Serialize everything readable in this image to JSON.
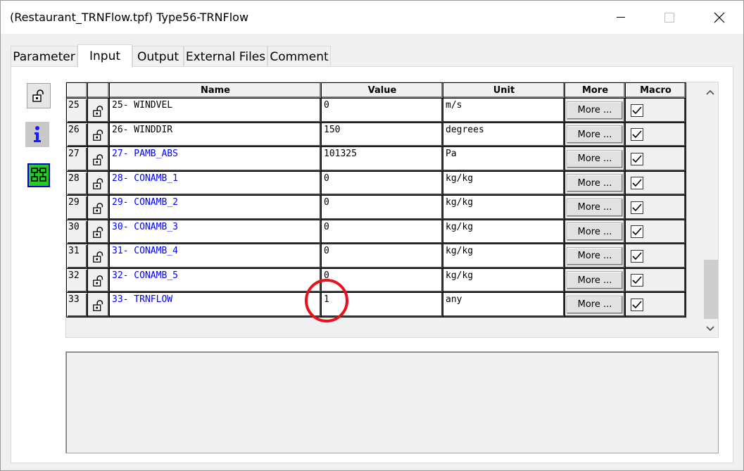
{
  "window": {
    "title": "(Restaurant_TRNFlow.tpf) Type56-TRNFlow"
  },
  "tabs": [
    {
      "label": "Parameter",
      "active": false
    },
    {
      "label": "Input",
      "active": true
    },
    {
      "label": "Output",
      "active": false
    },
    {
      "label": "External Files",
      "active": false
    },
    {
      "label": "Comment",
      "active": false
    }
  ],
  "side_buttons": [
    {
      "icon": "lock-icon"
    },
    {
      "icon": "info-icon"
    },
    {
      "icon": "grid-view-icon"
    }
  ],
  "grid": {
    "columns": [
      "",
      "",
      "Name",
      "Value",
      "Unit",
      "More",
      "Macro"
    ],
    "rows": [
      {
        "num": "25",
        "name": "25- WINDVEL",
        "value": "0",
        "unit": "m/s",
        "more": "More ...",
        "macro": true,
        "name_color": "black"
      },
      {
        "num": "26",
        "name": "26- WINDDIR",
        "value": "150",
        "unit": "degrees",
        "more": "More ...",
        "macro": true,
        "name_color": "black"
      },
      {
        "num": "27",
        "name": "27- PAMB_ABS",
        "value": "101325",
        "unit": "Pa",
        "more": "More ...",
        "macro": true,
        "name_color": "blue"
      },
      {
        "num": "28",
        "name": "28- CONAMB_1",
        "value": "0",
        "unit": "kg/kg",
        "more": "More ...",
        "macro": true,
        "name_color": "blue"
      },
      {
        "num": "29",
        "name": "29- CONAMB_2",
        "value": "0",
        "unit": "kg/kg",
        "more": "More ...",
        "macro": true,
        "name_color": "blue"
      },
      {
        "num": "30",
        "name": "30- CONAMB_3",
        "value": "0",
        "unit": "kg/kg",
        "more": "More ...",
        "macro": true,
        "name_color": "blue"
      },
      {
        "num": "31",
        "name": "31- CONAMB_4",
        "value": "0",
        "unit": "kg/kg",
        "more": "More ...",
        "macro": true,
        "name_color": "blue"
      },
      {
        "num": "32",
        "name": "32- CONAMB_5",
        "value": "0",
        "unit": "kg/kg",
        "more": "More ...",
        "macro": true,
        "name_color": "blue"
      },
      {
        "num": "33",
        "name": "33- TRNFLOW",
        "value": "1",
        "unit": "any",
        "more": "More ...",
        "macro": true,
        "name_color": "blue"
      }
    ]
  },
  "colors": {
    "highlight": "#e8111d",
    "blue_name": "#0000ff"
  }
}
